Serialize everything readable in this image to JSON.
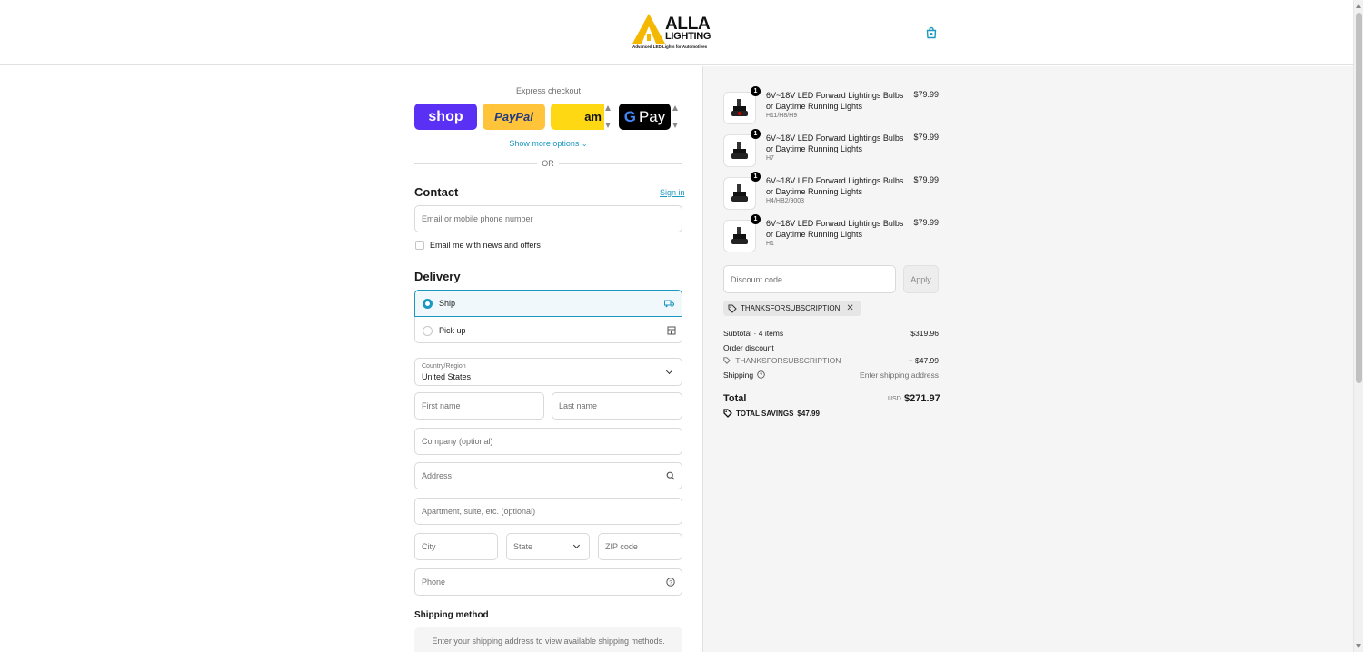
{
  "header": {
    "logo_main_line1": "ALLA",
    "logo_main_line2": "LIGHTING",
    "logo_tagline": "Advanced LED Lights for Automotives",
    "cart_icon": "shopping-bag-icon"
  },
  "express": {
    "label": "Express checkout",
    "shop": "shop",
    "paypal": "PayPal",
    "amazon": "am",
    "gpay": "G Pay",
    "show_more": "Show more options",
    "or": "OR"
  },
  "contact": {
    "title": "Contact",
    "sign_in": "Sign in",
    "email_placeholder": "Email or mobile phone number",
    "newsletter_label": "Email me with news and offers"
  },
  "delivery": {
    "title": "Delivery",
    "options": [
      {
        "label": "Ship",
        "selected": true,
        "icon": "truck-icon"
      },
      {
        "label": "Pick up",
        "selected": false,
        "icon": "store-icon"
      }
    ],
    "country_label": "Country/Region",
    "country_value": "United States",
    "first_name": "First name",
    "last_name": "Last name",
    "company": "Company (optional)",
    "address": "Address",
    "apartment": "Apartment, suite, etc. (optional)",
    "city": "City",
    "state": "State",
    "zip": "ZIP code",
    "phone": "Phone"
  },
  "shipping_method": {
    "title": "Shipping method",
    "note": "Enter your shipping address to view available shipping methods."
  },
  "cart": {
    "items": [
      {
        "qty": "1",
        "name": "6V~18V LED Forward Lightings Bulbs or Daytime Running Lights",
        "variant": "H11/H8/H9",
        "price": "$79.99"
      },
      {
        "qty": "1",
        "name": "6V~18V LED Forward Lightings Bulbs or Daytime Running Lights",
        "variant": "H7",
        "price": "$79.99"
      },
      {
        "qty": "1",
        "name": "6V~18V LED Forward Lightings Bulbs or Daytime Running Lights",
        "variant": "H4/HB2/9003",
        "price": "$79.99"
      },
      {
        "qty": "1",
        "name": "6V~18V LED Forward Lightings Bulbs or Daytime Running Lights",
        "variant": "H1",
        "price": "$79.99"
      }
    ],
    "discount_placeholder": "Discount code",
    "apply": "Apply",
    "applied_code": "THANKSFORSUBSCRIPTION"
  },
  "summary": {
    "subtotal_label": "Subtotal · 4 items",
    "subtotal_value": "$319.96",
    "order_discount_label": "Order discount",
    "discount_code": "THANKSFORSUBSCRIPTION",
    "discount_value": "− $47.99",
    "shipping_label": "Shipping",
    "shipping_value": "Enter shipping address",
    "total_label": "Total",
    "currency": "USD",
    "total_value": "$271.97",
    "savings_label": "TOTAL SAVINGS",
    "savings_value": "$47.99"
  },
  "colors": {
    "accent": "#1a98c0",
    "shop_purple": "#5a31f4",
    "paypal_yellow": "#ffc439",
    "amazon_yellow": "#ffd814",
    "logo_yellow": "#f5b800"
  }
}
